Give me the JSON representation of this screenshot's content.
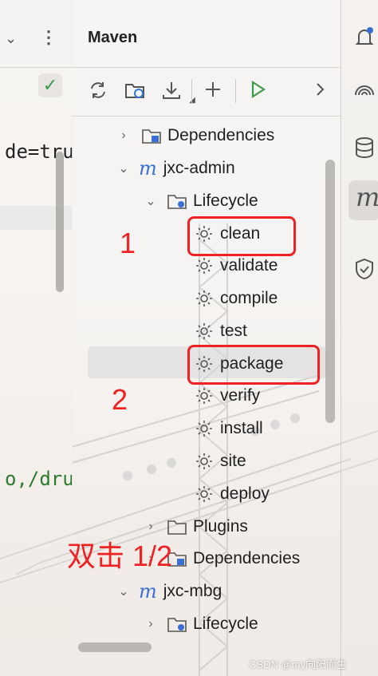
{
  "editor": {
    "code_line_1": "de=tru",
    "code_line_2": "o,/dru"
  },
  "maven": {
    "title": "Maven",
    "toolbar": [
      "reload-icon",
      "folder-refresh-icon",
      "download-icon",
      "add-icon",
      "run-icon",
      "more-icon"
    ],
    "tree": [
      {
        "label": "Dependencies"
      },
      {
        "label": "jxc-admin"
      },
      {
        "label": "Lifecycle"
      },
      {
        "label": "clean"
      },
      {
        "label": "validate"
      },
      {
        "label": "compile"
      },
      {
        "label": "test"
      },
      {
        "label": "package"
      },
      {
        "label": "verify"
      },
      {
        "label": "install"
      },
      {
        "label": "site"
      },
      {
        "label": "deploy"
      },
      {
        "label": "Plugins"
      },
      {
        "label": "Dependencies"
      },
      {
        "label": "jxc-mbg"
      },
      {
        "label": "Lifecycle"
      }
    ]
  },
  "annotations": {
    "step1": "1",
    "step2": "2",
    "double_click": "双击 1/2"
  },
  "colors": {
    "annotation_red": "#e22222",
    "maven_blue": "#3b6fd8",
    "run_green": "#3c9b4a"
  },
  "watermark": "CSDN @my向阳而生"
}
